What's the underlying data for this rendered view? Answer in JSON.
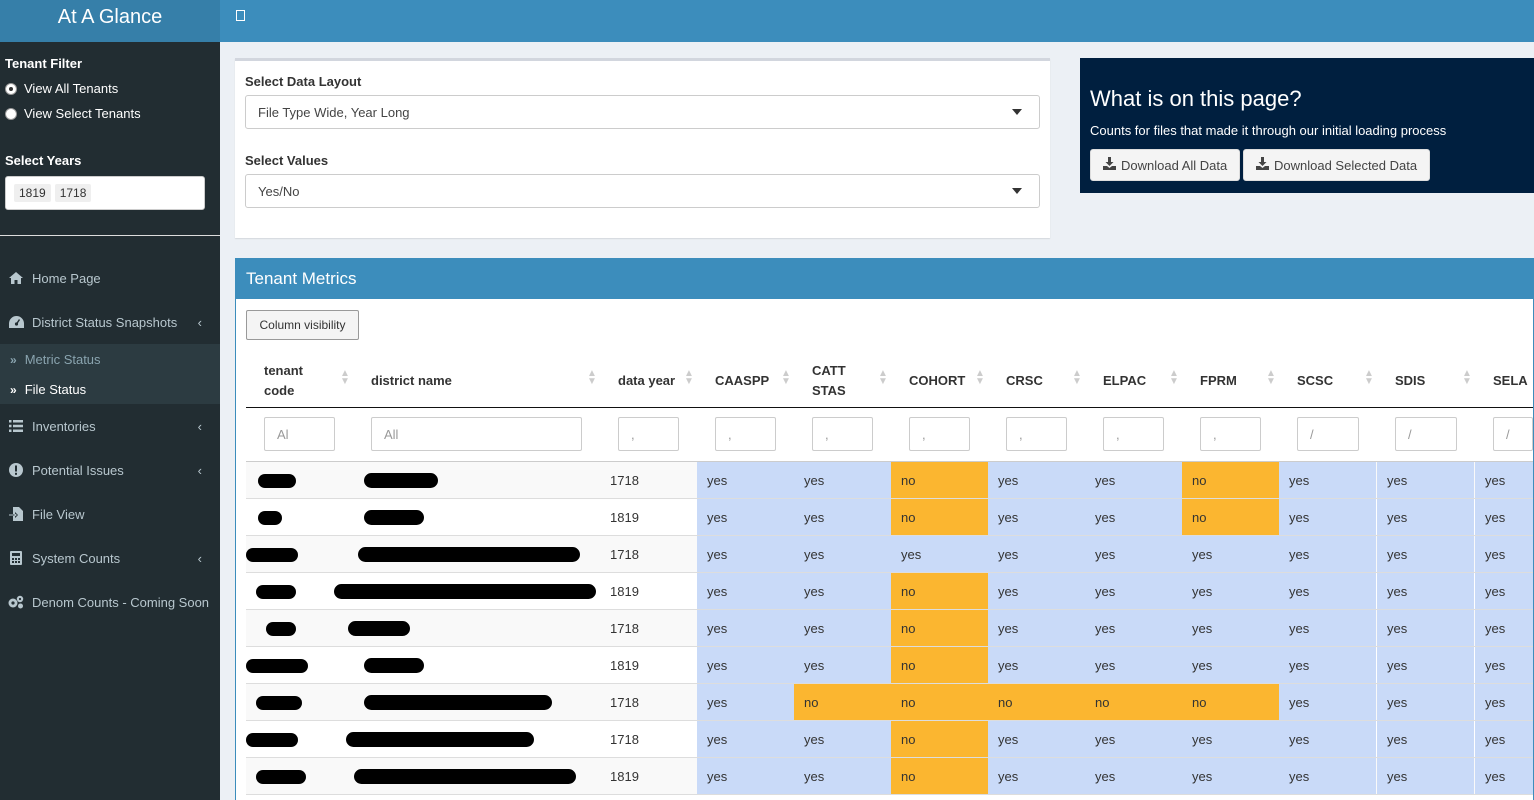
{
  "app": {
    "title": "At A Glance"
  },
  "sidebar": {
    "tenant_filter_label": "Tenant Filter",
    "radio_all": "View All Tenants",
    "radio_select": "View Select Tenants",
    "years_label": "Select Years",
    "years": [
      "1819",
      "1718"
    ],
    "menu": {
      "home": "Home Page",
      "district_status": "District Status Snapshots",
      "metric_status": "Metric Status",
      "file_status": "File Status",
      "inventories": "Inventories",
      "potential_issues": "Potential Issues",
      "file_view": "File View",
      "system_counts": "System Counts",
      "denom_counts": "Denom Counts - Coming Soon"
    }
  },
  "layout_box": {
    "layout_label": "Select Data Layout",
    "layout_value": "File Type Wide, Year Long",
    "values_label": "Select Values",
    "values_value": "Yes/No"
  },
  "info_box": {
    "heading": "What is on this page?",
    "subtext": "Counts for files that made it through our initial loading process",
    "download_all": "Download All Data",
    "download_selected": "Download Selected Data"
  },
  "table": {
    "title": "Tenant Metrics",
    "column_visibility": "Column visibility",
    "headers": {
      "tenant_code_1": "tenant",
      "tenant_code_2": "code",
      "district_name": "district name",
      "data_year": "data year",
      "caaspp": "CAASPP",
      "cattstas_1": "CATT",
      "cattstas_2": "STAS",
      "cohort": "COHORT",
      "crsc": "CRSC",
      "elpac": "ELPAC",
      "fprm": "FPRM",
      "scsc": "SCSC",
      "sdis": "SDIS",
      "sela": "SELA"
    },
    "filters": {
      "tenant_code": "Al",
      "district_name": "All",
      "numeric": ",",
      "slash": "/"
    },
    "rows": [
      {
        "year": "1718",
        "caaspp": "yes",
        "cattstas": "yes",
        "cohort": "no",
        "crsc": "yes",
        "elpac": "yes",
        "fprm": "no",
        "scsc": "yes",
        "sdis": "yes",
        "sela": "yes"
      },
      {
        "year": "1819",
        "caaspp": "yes",
        "cattstas": "yes",
        "cohort": "no",
        "crsc": "yes",
        "elpac": "yes",
        "fprm": "no",
        "scsc": "yes",
        "sdis": "yes",
        "sela": "yes"
      },
      {
        "year": "1718",
        "caaspp": "yes",
        "cattstas": "yes",
        "cohort": "yes",
        "crsc": "yes",
        "elpac": "yes",
        "fprm": "yes",
        "scsc": "yes",
        "sdis": "yes",
        "sela": "yes"
      },
      {
        "year": "1819",
        "caaspp": "yes",
        "cattstas": "yes",
        "cohort": "no",
        "crsc": "yes",
        "elpac": "yes",
        "fprm": "yes",
        "scsc": "yes",
        "sdis": "yes",
        "sela": "yes"
      },
      {
        "year": "1718",
        "caaspp": "yes",
        "cattstas": "yes",
        "cohort": "no",
        "crsc": "yes",
        "elpac": "yes",
        "fprm": "yes",
        "scsc": "yes",
        "sdis": "yes",
        "sela": "yes"
      },
      {
        "year": "1819",
        "caaspp": "yes",
        "cattstas": "yes",
        "cohort": "no",
        "crsc": "yes",
        "elpac": "yes",
        "fprm": "yes",
        "scsc": "yes",
        "sdis": "yes",
        "sela": "yes"
      },
      {
        "year": "1718",
        "caaspp": "yes",
        "cattstas": "no",
        "cohort": "no",
        "crsc": "no",
        "elpac": "no",
        "fprm": "no",
        "scsc": "yes",
        "sdis": "yes",
        "sela": "yes"
      },
      {
        "year": "1718",
        "caaspp": "yes",
        "cattstas": "yes",
        "cohort": "no",
        "crsc": "yes",
        "elpac": "yes",
        "fprm": "yes",
        "scsc": "yes",
        "sdis": "yes",
        "sela": "yes"
      },
      {
        "year": "1819",
        "caaspp": "yes",
        "cattstas": "yes",
        "cohort": "no",
        "crsc": "yes",
        "elpac": "yes",
        "fprm": "yes",
        "scsc": "yes",
        "sdis": "yes",
        "sela": "yes"
      }
    ]
  },
  "colors": {
    "header_blue": "#3c8dbc",
    "sidebar_dark": "#222d32",
    "info_navy": "#001f3f",
    "yes_cell": "#c9daf8",
    "no_cell": "#fbb630"
  },
  "icons": {
    "home": "home-icon",
    "dashboard": "dashboard-icon",
    "list": "list-icon",
    "alert": "alert-icon",
    "file": "file-import-icon",
    "calculator": "calculator-icon",
    "cogs": "cogs-icon",
    "download": "download-icon"
  }
}
